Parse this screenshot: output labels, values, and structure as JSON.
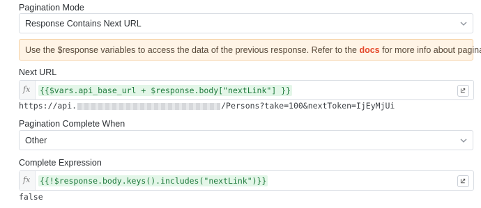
{
  "pagination_mode": {
    "label": "Pagination Mode",
    "selected": "Response Contains Next URL"
  },
  "info_banner": {
    "text_before": "Use the $response variables to access the data of the previous response. Refer to the ",
    "link": "docs",
    "text_after": " for more info about pagination/"
  },
  "next_url": {
    "label": "Next URL",
    "fx": "fx",
    "expression": "{{$vars.api_base_url + $response.body[\"nextLink\"] }}",
    "preview_start": "https://api.",
    "preview_end": "/Persons?take=100&nextToken=IjEyMjUi"
  },
  "pagination_complete": {
    "label": "Pagination Complete When",
    "selected": "Other"
  },
  "complete_expression": {
    "label": "Complete Expression",
    "fx": "fx",
    "expression": "{{!$response.body.keys().includes(\"nextLink\")}}",
    "preview": "false"
  },
  "colors": {
    "banner_bg": "#fff4e6",
    "link": "#e4492c",
    "expression_bg": "#e3f6e8",
    "expression_text": "#1f7a3c"
  }
}
